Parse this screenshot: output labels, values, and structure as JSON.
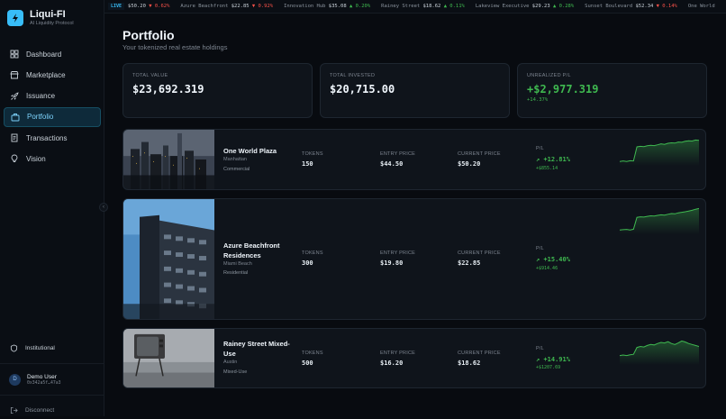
{
  "brand": {
    "title": "Liqui-FI",
    "subtitle": "AI Liquidity Protocol"
  },
  "nav": [
    {
      "label": "Dashboard",
      "icon": "grid-icon",
      "active": false
    },
    {
      "label": "Marketplace",
      "icon": "store-icon",
      "active": false
    },
    {
      "label": "Issuance",
      "icon": "rocket-icon",
      "active": false
    },
    {
      "label": "Portfolio",
      "icon": "briefcase-icon",
      "active": true
    },
    {
      "label": "Transactions",
      "icon": "receipt-icon",
      "active": false
    },
    {
      "label": "Vision",
      "icon": "lightbulb-icon",
      "active": false
    }
  ],
  "sidebar_bottom": {
    "institutional": "Institutional",
    "user_name": "Demo User",
    "user_initial": "D",
    "user_address": "0x342a5f…47a3",
    "disconnect": "Disconnect"
  },
  "ticker": {
    "live": "LIVE",
    "items": [
      {
        "name": "",
        "price": "$50.20",
        "change": "▼ 0.62%",
        "dir": "down"
      },
      {
        "name": "Azure Beachfront",
        "price": "$22.85",
        "change": "▼ 0.92%",
        "dir": "down"
      },
      {
        "name": "Innovation Hub",
        "price": "$35.08",
        "change": "▲ 0.20%",
        "dir": "up"
      },
      {
        "name": "Rainey Street",
        "price": "$18.62",
        "change": "▲ 0.11%",
        "dir": "up"
      },
      {
        "name": "Lakeview Executive",
        "price": "$29.23",
        "change": "▲ 0.28%",
        "dir": "up"
      },
      {
        "name": "Sunset Boulevard",
        "price": "$52.34",
        "change": "▼ 0.14%",
        "dir": "down"
      },
      {
        "name": "One World",
        "price": "",
        "change": "",
        "dir": "up"
      }
    ]
  },
  "page": {
    "title": "Portfolio",
    "subtitle": "Your tokenized real estate holdings"
  },
  "stats": [
    {
      "label": "TOTAL VALUE",
      "value": "$23,692.319",
      "sub": ""
    },
    {
      "label": "TOTAL INVESTED",
      "value": "$20,715.00",
      "sub": ""
    },
    {
      "label": "UNREALIZED P/L",
      "value": "+$2,977.319",
      "sub": "+14.37%"
    }
  ],
  "columns": {
    "tokens": "TOKENS",
    "entry": "ENTRY PRICE",
    "current": "CURRENT PRICE",
    "pl": "P/L"
  },
  "holdings": [
    {
      "name": "One World Plaza",
      "city": "Manhattan",
      "type": "Commercial",
      "tokens": "150",
      "entry": "$44.50",
      "current": "$50.20",
      "pl_pct": "+12.81%",
      "pl_amt": "+$855.14",
      "spark": [
        0.1,
        0.12,
        0.1,
        0.13,
        0.12,
        0.68,
        0.7,
        0.69,
        0.72,
        0.74,
        0.73,
        0.76,
        0.8,
        0.78,
        0.82,
        0.84,
        0.83,
        0.87,
        0.86,
        0.9,
        0.92,
        0.91,
        0.95,
        0.94
      ]
    },
    {
      "name": "Azure Beachfront Residences",
      "city": "Miami Beach",
      "type": "Residential",
      "tokens": "300",
      "entry": "$19.80",
      "current": "$22.85",
      "pl_pct": "+15.40%",
      "pl_amt": "+$914.46",
      "spark": [
        0.1,
        0.11,
        0.12,
        0.1,
        0.13,
        0.6,
        0.62,
        0.61,
        0.64,
        0.66,
        0.65,
        0.68,
        0.7,
        0.69,
        0.72,
        0.75,
        0.74,
        0.78,
        0.8,
        0.82,
        0.85,
        0.88,
        0.92,
        0.95
      ]
    },
    {
      "name": "Rainey Street Mixed-Use",
      "city": "Austin",
      "type": "Mixed-Use",
      "tokens": "500",
      "entry": "$16.20",
      "current": "$18.62",
      "pl_pct": "+14.91%",
      "pl_amt": "+$1207.69",
      "spark": [
        0.3,
        0.32,
        0.3,
        0.33,
        0.35,
        0.62,
        0.66,
        0.64,
        0.7,
        0.74,
        0.72,
        0.78,
        0.82,
        0.8,
        0.85,
        0.78,
        0.74,
        0.8,
        0.88,
        0.84,
        0.78,
        0.74,
        0.7,
        0.66
      ]
    }
  ],
  "colors": {
    "accent": "#38bdf8",
    "positive": "#3fb950",
    "negative": "#f85149"
  }
}
